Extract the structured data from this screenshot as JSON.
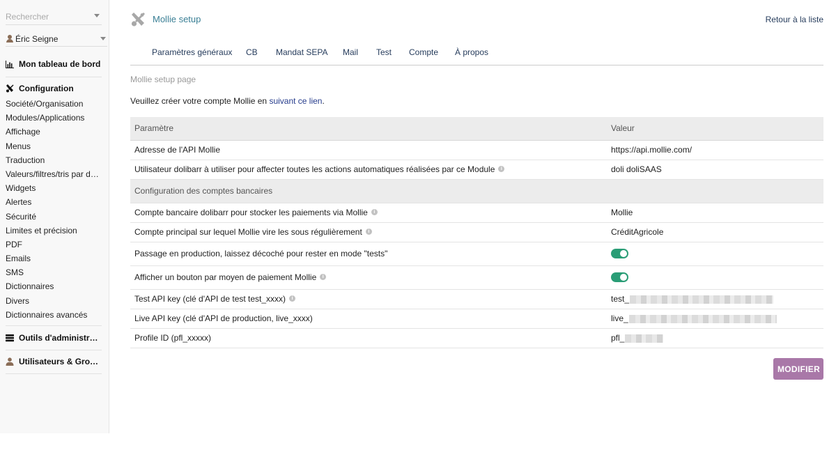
{
  "sidebar": {
    "search_placeholder": "Rechercher",
    "user_name": "Éric Seigne",
    "dashboard_label": "Mon tableau de bord",
    "config_label": "Configuration",
    "config_items": [
      "Société/Organisation",
      "Modules/Applications",
      "Affichage",
      "Menus",
      "Traduction",
      "Valeurs/filtres/tris par défaut",
      "Widgets",
      "Alertes",
      "Sécurité",
      "Limites et précision",
      "PDF",
      "Emails",
      "SMS",
      "Dictionnaires",
      "Divers",
      "Dictionnaires avancés"
    ],
    "admin_tools_label": "Outils d'administration",
    "users_groups_label": "Utilisateurs & Groupes"
  },
  "header": {
    "title": "Mollie setup",
    "back_link": "Retour à la liste"
  },
  "tabs": [
    {
      "label": "Paramètres généraux"
    },
    {
      "label": "CB"
    },
    {
      "label": "Mandat SEPA"
    },
    {
      "label": "Mail"
    },
    {
      "label": "Test"
    },
    {
      "label": "Compte"
    },
    {
      "label": "À propos"
    }
  ],
  "main": {
    "subtitle": "Mollie setup page",
    "intro_text": "Veuillez créer votre compte Mollie en ",
    "intro_link": "suivant ce lien",
    "intro_end": "."
  },
  "table": {
    "col_param": "Paramètre",
    "col_value": "Valeur",
    "rows": [
      {
        "label": "Adresse de l'API Mollie",
        "value": "https://api.mollie.com/"
      },
      {
        "label": "Utilisateur dolibarr à utiliser pour affecter toutes les actions automatiques réalisées par ce Module",
        "value": "doli doliSAAS"
      }
    ],
    "group_label": "Configuration des comptes bancaires",
    "bank_rows": [
      {
        "label": "Compte bancaire dolibarr pour stocker les paiements via Mollie",
        "value": "Mollie"
      },
      {
        "label": "Compte principal sur lequel Mollie vire les sous régulièrement",
        "value": "CréditAgricole"
      }
    ],
    "toggle_rows": [
      {
        "label": "Passage en production, laissez décoché pour rester en mode \"tests\"",
        "on": true
      },
      {
        "label": "Afficher un bouton par moyen de paiement Mollie",
        "on": true
      }
    ],
    "key_rows": [
      {
        "label": "Test API key (clé d'API de test test_xxxx)",
        "value_prefix": "test_"
      },
      {
        "label": "Live API key (clé d'API de production, live_xxxx)",
        "value_prefix": "live_"
      },
      {
        "label": "Profile ID (pfl_xxxxx)",
        "value_prefix": "pfl_"
      }
    ]
  },
  "actions": {
    "modify_label": "MODIFIER"
  },
  "colors": {
    "accent_title": "#3a7f95",
    "toggle_on": "#2a9d76",
    "button": "#a978a8"
  },
  "icons": {
    "title": "tools-icon",
    "dashboard": "chart-icon",
    "config": "tools-icon",
    "admin": "server-icon",
    "users": "user-icon",
    "info": "info-icon"
  }
}
